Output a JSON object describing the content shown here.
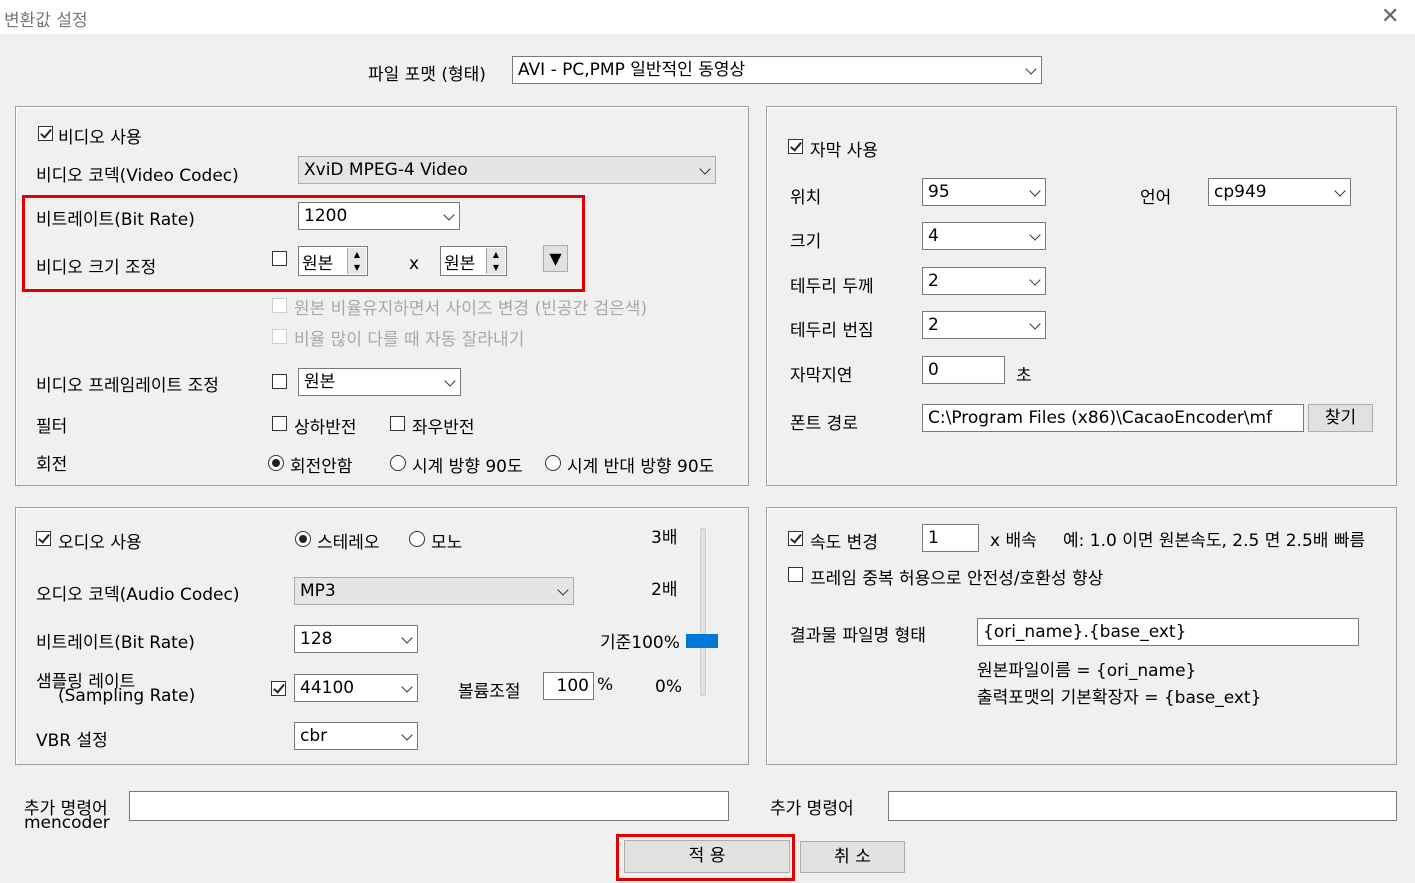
{
  "window": {
    "title": "변환값 설정",
    "close_icon": "✕"
  },
  "format": {
    "label": "파일 포맷 (형태)",
    "value": "AVI - PC,PMP 일반적인 동영상"
  },
  "video": {
    "use_label": "비디오 사용",
    "codec_label": "비디오 코덱(Video Codec)",
    "codec_value": "XviD MPEG-4 Video",
    "bitrate_label": "비트레이트(Bit Rate)",
    "bitrate_value": "1200",
    "size_label": "비디오 크기 조정",
    "width_value": "원본",
    "height_value": "원본",
    "x_label": "x",
    "keep_ratio_label": "원본 비율유지하면서 사이즈 변경 (빈공간 검은색)",
    "crop_label": "비율 많이 다를 때 자동 잘라내기",
    "framerate_label": "비디오 프레임레이트 조정",
    "framerate_value": "원본",
    "filter_label": "필터",
    "flip_v_label": "상하반전",
    "flip_h_label": "좌우반전",
    "rotate_label": "회전",
    "rotate_none": "회전안함",
    "rotate_cw": "시계 방향 90도",
    "rotate_ccw": "시계 반대 방향 90도"
  },
  "subtitle": {
    "use_label": "자막 사용",
    "position_label": "위치",
    "position_value": "95",
    "language_label": "언어",
    "language_value": "cp949",
    "size_label": "크기",
    "size_value": "4",
    "border_label": "테두리 두께",
    "border_value": "2",
    "blur_label": "테두리 번짐",
    "blur_value": "2",
    "delay_label": "자막지연",
    "delay_value": "0",
    "delay_unit": "초",
    "font_label": "폰트 경로",
    "font_value": "C:\\Program Files (x86)\\CacaoEncoder\\mf",
    "browse_label": "찾기"
  },
  "audio": {
    "use_label": "오디오 사용",
    "stereo_label": "스테레오",
    "mono_label": "모노",
    "codec_label": "오디오 코덱(Audio Codec)",
    "codec_value": "MP3",
    "bitrate_label": "비트레이트(Bit Rate)",
    "bitrate_value": "128",
    "sample_label_1": "샘플링 레이트",
    "sample_label_2": "(Sampling Rate)",
    "sample_value": "44100",
    "volume_label": "볼륨조절",
    "volume_value": "100",
    "volume_unit": "%",
    "vbr_label": "VBR 설정",
    "vbr_value": "cbr",
    "scale_3x": "3배",
    "scale_2x": "2배",
    "scale_base": "기준100%",
    "scale_0": "0%",
    "volume_level": 0.33
  },
  "speed": {
    "change_label": "속도 변경",
    "value": "1",
    "unit_label": "x 배속",
    "example": "예: 1.0 이면 원본속도, 2.5 면 2.5배 빠름",
    "dup_label": "프레임 중복 허용으로 안전성/호환성 향상",
    "filename_label": "결과물 파일명 형태",
    "filename_value": "{ori_name}.{base_ext}",
    "hint1": "원본파일이름 = {ori_name}",
    "hint2": "출력포맷의 기본확장자 = {base_ext}"
  },
  "extra": {
    "mencoder_label_1": "추가 명령어",
    "mencoder_label_2": "mencoder",
    "mencoder_value": "",
    "other_label": "추가 명령어",
    "other_value": ""
  },
  "buttons": {
    "apply": "적 용",
    "cancel": "취 소"
  },
  "colors": {
    "highlight": "#e00000",
    "slider_thumb": "#0078d7"
  }
}
